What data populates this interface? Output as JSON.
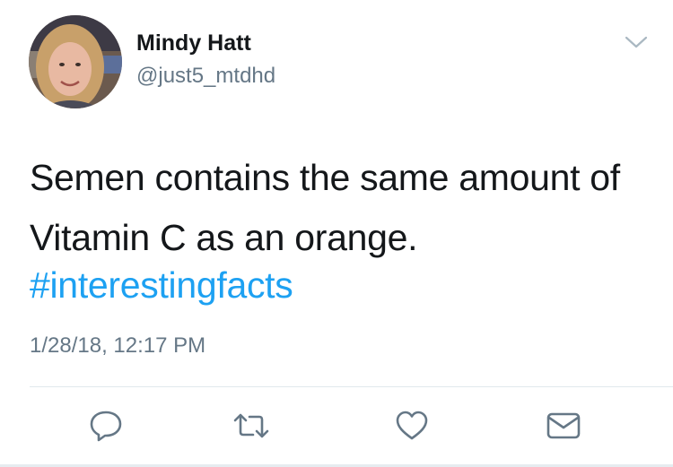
{
  "tweet": {
    "author": {
      "display_name": "Mindy Hatt",
      "handle": "@just5_mtdhd",
      "avatar_icon": "profile-photo"
    },
    "text_lines": [
      "Semen contains the same amount of",
      "Vitamin C as an orange."
    ],
    "hashtag": "#interestingfacts",
    "timestamp": "1/28/18, 12:17 PM",
    "actions": [
      {
        "name": "reply",
        "icon": "speech-bubble-icon"
      },
      {
        "name": "retweet",
        "icon": "retweet-arrows-icon"
      },
      {
        "name": "like",
        "icon": "heart-icon"
      },
      {
        "name": "direct-message",
        "icon": "envelope-icon"
      }
    ],
    "colors": {
      "text": "#14171a",
      "secondary": "#657786",
      "link": "#1da1f2",
      "icon": "#657786",
      "divider": "#e1e8ed"
    }
  }
}
